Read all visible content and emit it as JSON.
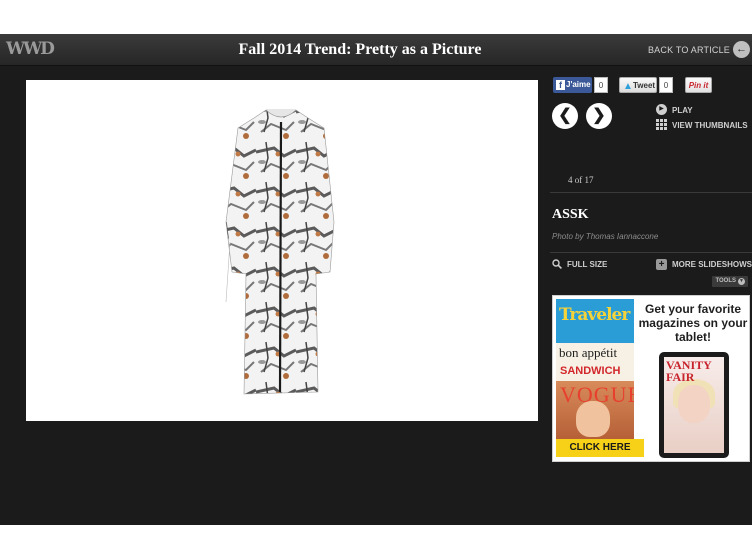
{
  "header": {
    "logo": "WWD",
    "title": "Fall 2014 Trend: Pretty as a Picture",
    "back_label": "BACK TO ARTICLE"
  },
  "social": {
    "facebook_label": "J'aime",
    "facebook_count": "0",
    "tweet_label": "Tweet",
    "tweet_count": "0",
    "pinit_label": "Pin it"
  },
  "slideshow": {
    "prev_icon": "chevron-left-icon",
    "next_icon": "chevron-right-icon",
    "counter": "4 of 17",
    "play_label": "PLAY",
    "thumbnails_label": "VIEW THUMBNAILS",
    "designer": "ASSK",
    "credit": "Photo by Thomas Iannaccone",
    "full_size_label": "FULL SIZE",
    "more_label": "MORE SLIDESHOWS",
    "tools_label": "TOOLS"
  },
  "ad": {
    "mag1": "Traveler",
    "mag2": "bon appétit",
    "mag3": "SANDWICH",
    "mag4": "VOGUE",
    "tablet_mag": "VANITY FAIR",
    "headline": "Get your favorite magazines on your tablet!",
    "cta": "CLICK HERE"
  },
  "colors": {
    "background": "#1b1b1b",
    "facebook": "#3b5998",
    "cta_yellow": "#f6d118"
  }
}
